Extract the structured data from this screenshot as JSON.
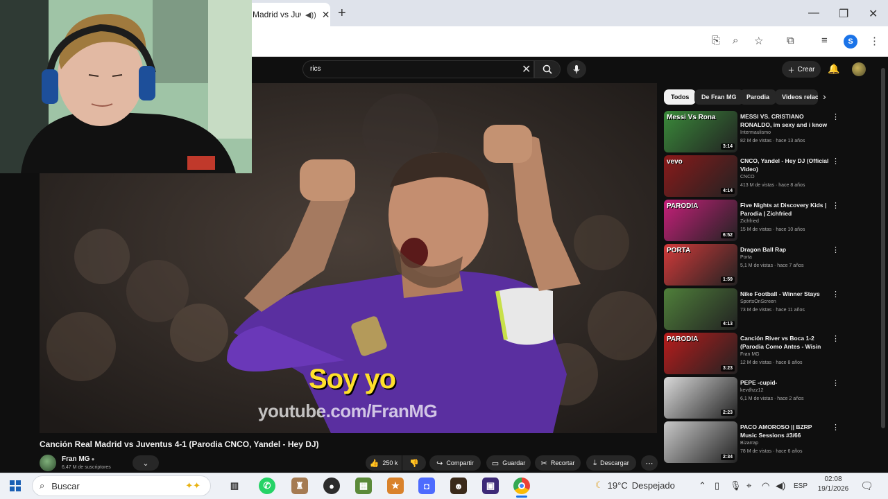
{
  "browser": {
    "tab_title": "Madrid vs Juve",
    "tab_audio_icon": "speaker-icon",
    "tab_close": "✕",
    "new_tab": "+",
    "profile_initial": "S"
  },
  "youtube_header": {
    "search_value": "rics",
    "search_clear": "✕",
    "create_label": "Crear"
  },
  "video": {
    "subtitle": "Soy yo",
    "watermark": "youtube.com/FranMG",
    "title": "Canción Real Madrid vs Juventus 4-1 (Parodia CNCO, Yandel - Hey DJ)",
    "channel_name": "Fran MG",
    "channel_subs": "6,47 M de suscriptores",
    "actions": {
      "like_count": "250 k",
      "share": "Compartir",
      "save": "Guardar",
      "clip": "Recortar",
      "download": "Descargar"
    }
  },
  "chips": [
    "Todos",
    "De Fran MG",
    "Parodia",
    "Videos relac"
  ],
  "recommendations": [
    {
      "title": "MESSI VS. CRISTIANO RONALDO, im sexy and i know ...",
      "channel": "Intermaulismo",
      "meta": "82 M de vistas · hace 13 años",
      "duration": "3:14",
      "thumb_color": "#3a8a3a",
      "overlay": "Messi Vs Rona"
    },
    {
      "title": "CNCO, Yandel - Hey DJ (Official Video)",
      "channel": "CNCO",
      "meta": "413 M de vistas · hace 8 años",
      "duration": "4:14",
      "thumb_color": "#8a1a1a",
      "overlay": "vevo"
    },
    {
      "title": "Five Nights at Discovery Kids | Parodia | Zichfried",
      "channel": "Zichfried",
      "meta": "15 M de vistas · hace 10 años",
      "duration": "6:52",
      "thumb_color": "#c6207a",
      "overlay": "PARODIA"
    },
    {
      "title": "Dragon Ball Rap",
      "channel": "Porta",
      "meta": "5,1 M de vistas · hace 7 años",
      "duration": "1:59",
      "thumb_color": "#d23a3a",
      "overlay": "PORTA"
    },
    {
      "title": "Nike Football - Winner Stays",
      "channel": "SportsOnScreen",
      "meta": "73 M de vistas · hace 11 años",
      "duration": "4:13",
      "thumb_color": "#4f7f3a",
      "overlay": ""
    },
    {
      "title": "Canción River vs Boca 1-2 (Parodia Como Antes - Wisin y...",
      "channel": "Fran MG",
      "meta": "12 M de vistas · hace 8 años",
      "duration": "3:23",
      "thumb_color": "#b91c1c",
      "overlay": "PARODIA"
    },
    {
      "title": "PEPE -cupid-",
      "channel": "kevdhzz12",
      "meta": "6,1 M de vistas · hace 2 años",
      "duration": "2:23",
      "thumb_color": "#d9d9d9",
      "overlay": ""
    },
    {
      "title": "PACO AMOROSO || BZRP Music Sessions #3/66",
      "channel": "Bizarrap",
      "meta": "78 M de vistas · hace 6 años",
      "duration": "2:34",
      "thumb_color": "#c8c8c8",
      "overlay": ""
    }
  ],
  "taskbar": {
    "search_label": "Buscar",
    "weather_temp": "19°C",
    "weather_desc": "Despejado",
    "lang": "ESP",
    "time": "02:08",
    "date": "19/1/2026"
  }
}
